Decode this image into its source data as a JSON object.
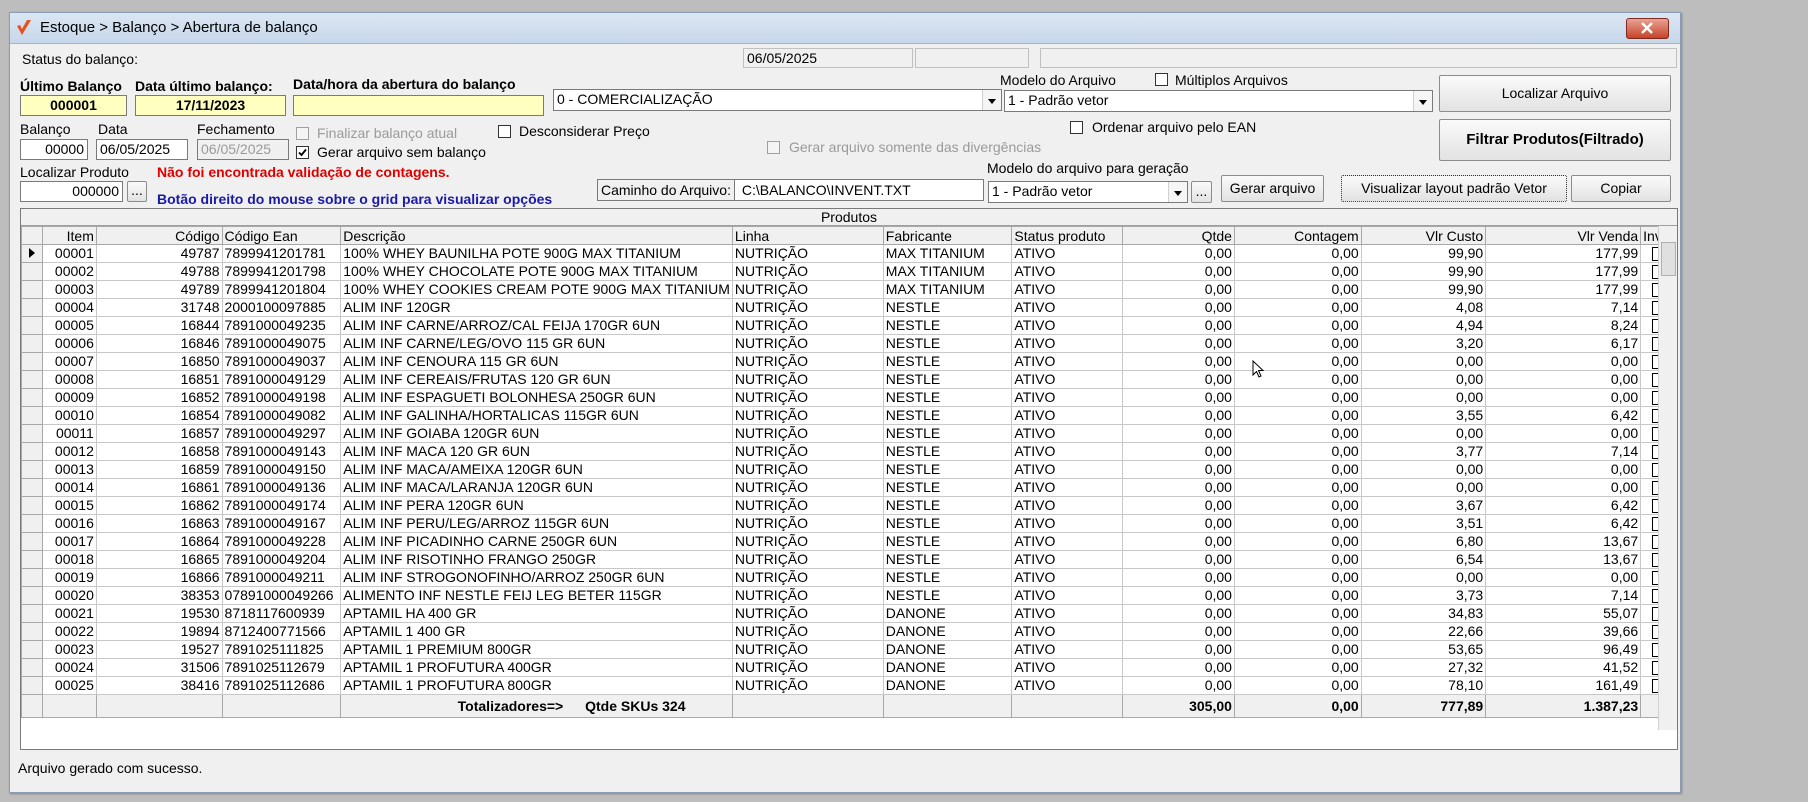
{
  "window": {
    "title": "Estoque > Balanço > Abertura de balanço"
  },
  "header": {
    "status_label": "Status do balanço:",
    "status_date": "06/05/2025",
    "ultimo_balanco_label": "Último Balanço",
    "ultimo_balanco_value": "000001",
    "data_ultimo_label": "Data último balanço:",
    "data_ultimo_value": "17/11/2023",
    "data_abertura_label": "Data/hora da abertura do balanço",
    "data_abertura_value": "",
    "tipo_select": "0 - COMERCIALIZAÇÃO",
    "modelo_arquivo_label": "Modelo do Arquivo",
    "modelo_arquivo_value": "1 - Padrão vetor",
    "multiplos_label": "Múltiplos Arquivos",
    "localizar_arquivo_btn": "Localizar Arquivo",
    "balanco_label": "Balanço",
    "balanco_value": "00000",
    "data_label": "Data",
    "data_value": "06/05/2025",
    "fechamento_label": "Fechamento",
    "fechamento_value": "06/05/2025",
    "finalizar_label": "Finalizar balanço atual",
    "gerar_sem_balanco_label": "Gerar arquivo sem balanço",
    "desconsiderar_label": "Desconsiderar Preço",
    "ordenar_ean_label": "Ordenar arquivo pelo EAN",
    "gerar_divergencias_label": "Gerar arquivo somente das divergências",
    "filtrar_btn": "Filtrar Produtos(Filtrado)",
    "localizar_produto_label": "Localizar Produto",
    "localizar_produto_value": "000000",
    "ellipsis": "...",
    "warning_text": "Não foi encontrada validação de contagens.",
    "hint_text": "Botão direito do mouse sobre o grid para visualizar opções",
    "caminho_label": "Caminho do Arquivo:",
    "caminho_value": "C:\\BALANCO\\INVENT.TXT",
    "modelo_geracao_label": "Modelo do arquivo para geração",
    "modelo_geracao_value": "1 - Padrão vetor",
    "gerar_arquivo_btn": "Gerar arquivo",
    "visualizar_btn": "Visualizar layout padrão Vetor",
    "copiar_btn": "Copiar",
    "colors": {
      "yellow_field": "#ffffc0",
      "warning": "#e00000",
      "hint": "#1a1aa8"
    }
  },
  "grid": {
    "caption": "Produtos",
    "columns": [
      "Item",
      "Código",
      "Código Ean",
      "Descrição",
      "Linha",
      "Fabricante",
      "Status produto",
      "Qtde",
      "Contagem",
      "Vlr Custo",
      "Vlr Venda",
      "Inve"
    ],
    "rows": [
      [
        "00001",
        "49787",
        "7899941201781",
        "100% WHEY BAUNILHA POTE 900G MAX TITANIUM",
        "NUTRIÇÃO",
        "MAX TITANIUM",
        "ATIVO",
        "0,00",
        "0,00",
        "99,90",
        "177,99"
      ],
      [
        "00002",
        "49788",
        "7899941201798",
        "100% WHEY CHOCOLATE POTE 900G MAX TITANIUM",
        "NUTRIÇÃO",
        "MAX TITANIUM",
        "ATIVO",
        "0,00",
        "0,00",
        "99,90",
        "177,99"
      ],
      [
        "00003",
        "49789",
        "7899941201804",
        "100% WHEY COOKIES CREAM POTE 900G MAX TITANIUM",
        "NUTRIÇÃO",
        "MAX TITANIUM",
        "ATIVO",
        "0,00",
        "0,00",
        "99,90",
        "177,99"
      ],
      [
        "00004",
        "31748",
        "2000100097885",
        "ALIM INF 120GR",
        "NUTRIÇÃO",
        "NESTLE",
        "ATIVO",
        "0,00",
        "0,00",
        "4,08",
        "7,14"
      ],
      [
        "00005",
        "16844",
        "7891000049235",
        "ALIM INF CARNE/ARROZ/CAL FEIJA 170GR 6UN",
        "NUTRIÇÃO",
        "NESTLE",
        "ATIVO",
        "0,00",
        "0,00",
        "4,94",
        "8,24"
      ],
      [
        "00006",
        "16846",
        "7891000049075",
        "ALIM INF CARNE/LEG/OVO 115 GR 6UN",
        "NUTRIÇÃO",
        "NESTLE",
        "ATIVO",
        "0,00",
        "0,00",
        "3,20",
        "6,17"
      ],
      [
        "00007",
        "16850",
        "7891000049037",
        "ALIM INF CENOURA 115 GR 6UN",
        "NUTRIÇÃO",
        "NESTLE",
        "ATIVO",
        "0,00",
        "0,00",
        "0,00",
        "0,00"
      ],
      [
        "00008",
        "16851",
        "7891000049129",
        "ALIM INF CEREAIS/FRUTAS 120 GR 6UN",
        "NUTRIÇÃO",
        "NESTLE",
        "ATIVO",
        "0,00",
        "0,00",
        "0,00",
        "0,00"
      ],
      [
        "00009",
        "16852",
        "7891000049198",
        "ALIM INF ESPAGUETI BOLONHESA 250GR 6UN",
        "NUTRIÇÃO",
        "NESTLE",
        "ATIVO",
        "0,00",
        "0,00",
        "0,00",
        "0,00"
      ],
      [
        "00010",
        "16854",
        "7891000049082",
        "ALIM INF GALINHA/HORTALICAS 115GR 6UN",
        "NUTRIÇÃO",
        "NESTLE",
        "ATIVO",
        "0,00",
        "0,00",
        "3,55",
        "6,42"
      ],
      [
        "00011",
        "16857",
        "7891000049297",
        "ALIM INF GOIABA 120GR 6UN",
        "NUTRIÇÃO",
        "NESTLE",
        "ATIVO",
        "0,00",
        "0,00",
        "0,00",
        "0,00"
      ],
      [
        "00012",
        "16858",
        "7891000049143",
        "ALIM INF MACA 120 GR 6UN",
        "NUTRIÇÃO",
        "NESTLE",
        "ATIVO",
        "0,00",
        "0,00",
        "3,77",
        "7,14"
      ],
      [
        "00013",
        "16859",
        "7891000049150",
        "ALIM INF MACA/AMEIXA 120GR 6UN",
        "NUTRIÇÃO",
        "NESTLE",
        "ATIVO",
        "0,00",
        "0,00",
        "0,00",
        "0,00"
      ],
      [
        "00014",
        "16861",
        "7891000049136",
        "ALIM INF MACA/LARANJA 120GR 6UN",
        "NUTRIÇÃO",
        "NESTLE",
        "ATIVO",
        "0,00",
        "0,00",
        "0,00",
        "0,00"
      ],
      [
        "00015",
        "16862",
        "7891000049174",
        "ALIM INF PERA 120GR 6UN",
        "NUTRIÇÃO",
        "NESTLE",
        "ATIVO",
        "0,00",
        "0,00",
        "3,67",
        "6,42"
      ],
      [
        "00016",
        "16863",
        "7891000049167",
        "ALIM INF PERU/LEG/ARROZ 115GR 6UN",
        "NUTRIÇÃO",
        "NESTLE",
        "ATIVO",
        "0,00",
        "0,00",
        "3,51",
        "6,42"
      ],
      [
        "00017",
        "16864",
        "7891000049228",
        "ALIM INF PICADINHO CARNE 250GR 6UN",
        "NUTRIÇÃO",
        "NESTLE",
        "ATIVO",
        "0,00",
        "0,00",
        "6,80",
        "13,67"
      ],
      [
        "00018",
        "16865",
        "7891000049204",
        "ALIM INF RISOTINHO FRANGO 250GR",
        "NUTRIÇÃO",
        "NESTLE",
        "ATIVO",
        "0,00",
        "0,00",
        "6,54",
        "13,67"
      ],
      [
        "00019",
        "16866",
        "7891000049211",
        "ALIM INF STROGONOFINHO/ARROZ 250GR 6UN",
        "NUTRIÇÃO",
        "NESTLE",
        "ATIVO",
        "0,00",
        "0,00",
        "0,00",
        "0,00"
      ],
      [
        "00020",
        "38353",
        "07891000049266",
        "ALIMENTO INF NESTLE FEIJ LEG BETER 115GR",
        "NUTRIÇÃO",
        "NESTLE",
        "ATIVO",
        "0,00",
        "0,00",
        "3,73",
        "7,14"
      ],
      [
        "00021",
        "19530",
        "8718117600939",
        "APTAMIL  HA  400 GR",
        "NUTRIÇÃO",
        "DANONE",
        "ATIVO",
        "0,00",
        "0,00",
        "34,83",
        "55,07"
      ],
      [
        "00022",
        "19894",
        "8712400771566",
        "APTAMIL 1 400 GR",
        "NUTRIÇÃO",
        "DANONE",
        "ATIVO",
        "0,00",
        "0,00",
        "22,66",
        "39,66"
      ],
      [
        "00023",
        "19527",
        "7891025111825",
        "APTAMIL 1 PREMIUM 800GR",
        "NUTRIÇÃO",
        "DANONE",
        "ATIVO",
        "0,00",
        "0,00",
        "53,65",
        "96,49"
      ],
      [
        "00024",
        "31506",
        "7891025112679",
        "APTAMIL 1 PROFUTURA 400GR",
        "NUTRIÇÃO",
        "DANONE",
        "ATIVO",
        "0,00",
        "0,00",
        "27,32",
        "41,52"
      ],
      [
        "00025",
        "38416",
        "7891025112686",
        "APTAMIL 1 PROFUTURA 800GR",
        "NUTRIÇÃO",
        "DANONE",
        "ATIVO",
        "0,00",
        "0,00",
        "78,10",
        "161,49"
      ]
    ],
    "totals": {
      "label": "Totalizadores=>",
      "skus": "Qtde SKUs 324",
      "qtde": "305,00",
      "contagem": "0,00",
      "custo": "777,89",
      "venda": "1.387,23"
    }
  },
  "status_bar": {
    "message": "Arquivo gerado com sucesso."
  }
}
